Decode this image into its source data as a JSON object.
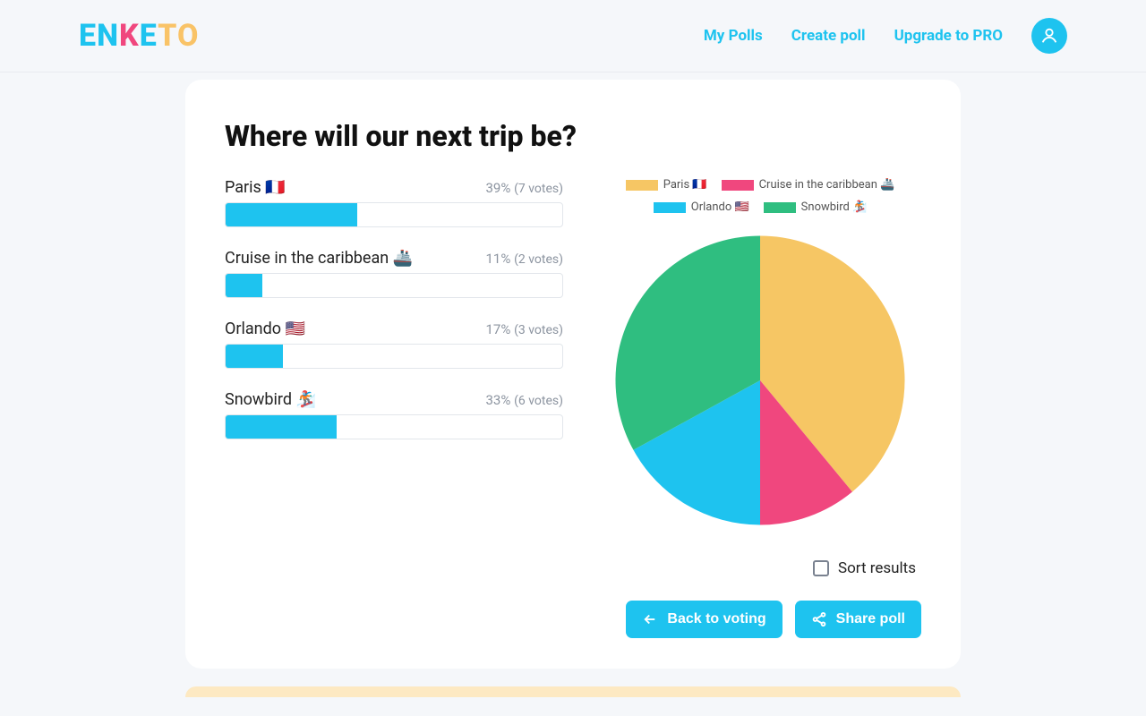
{
  "header": {
    "logo": "ENKETO",
    "nav": {
      "my_polls": "My Polls",
      "create_poll": "Create poll",
      "upgrade": "Upgrade to PRO"
    }
  },
  "poll": {
    "title": "Where will our next trip be?",
    "options": [
      {
        "label": "Paris 🇫🇷",
        "percent": 39,
        "percent_text": "39%",
        "votes_text": "(7 votes)",
        "votes": 7
      },
      {
        "label": "Cruise in the caribbean 🚢",
        "percent": 11,
        "percent_text": "11%",
        "votes_text": "(2 votes)",
        "votes": 2
      },
      {
        "label": "Orlando 🇺🇸",
        "percent": 17,
        "percent_text": "17%",
        "votes_text": "(3 votes)",
        "votes": 3
      },
      {
        "label": "Snowbird 🏂",
        "percent": 33,
        "percent_text": "33%",
        "votes_text": "(6 votes)",
        "votes": 6
      }
    ]
  },
  "chart_data": {
    "type": "pie",
    "series": [
      {
        "name": "Paris 🇫🇷",
        "value": 39,
        "color": "#f6c664"
      },
      {
        "name": "Cruise in the caribbean 🚢",
        "value": 11,
        "color": "#f0477e"
      },
      {
        "name": "Orlando 🇺🇸",
        "value": 17,
        "color": "#1ec3ef"
      },
      {
        "name": "Snowbird 🏂",
        "value": 33,
        "color": "#2fbe80"
      }
    ]
  },
  "controls": {
    "sort_label": "Sort results",
    "back_label": "Back to voting",
    "share_label": "Share poll"
  }
}
